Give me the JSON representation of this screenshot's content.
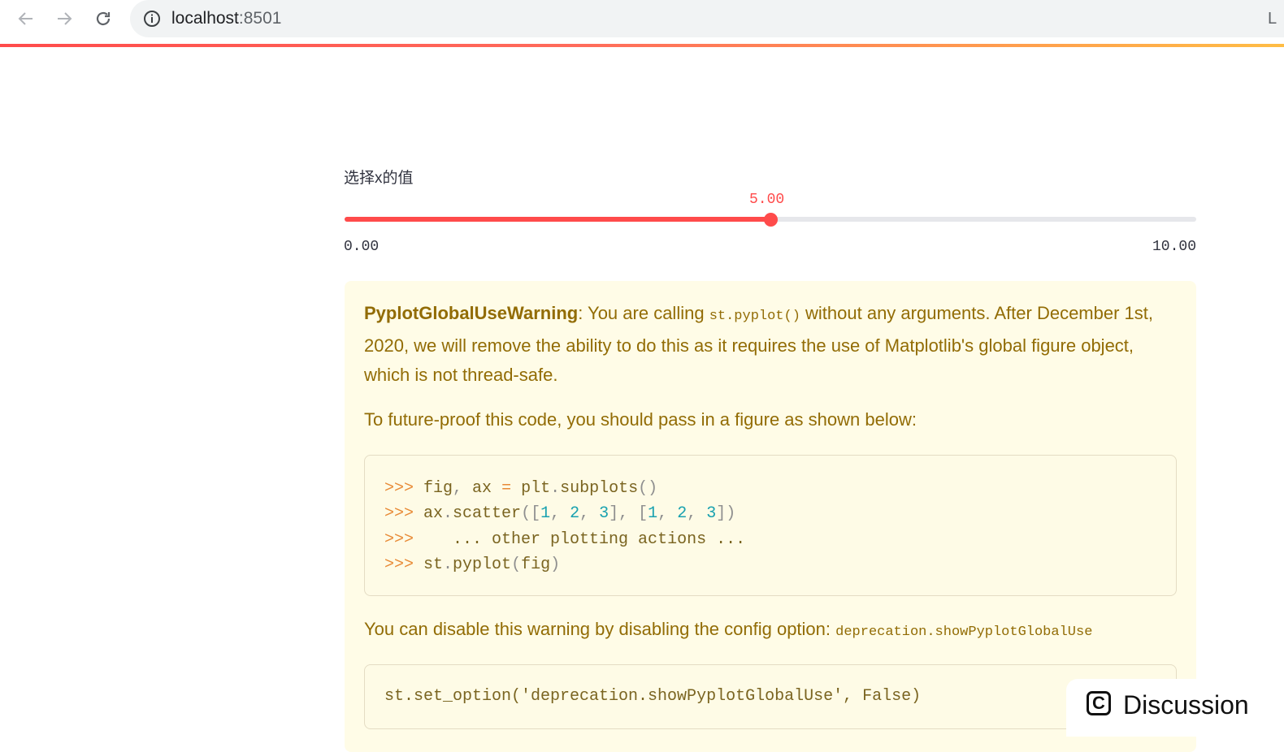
{
  "browser": {
    "url_host": "localhost",
    "url_port": ":8501",
    "edge_glyph": "L"
  },
  "slider": {
    "label": "选择x的值",
    "value_text": "5.00",
    "min_text": "0.00",
    "max_text": "10.00",
    "fraction": 0.5,
    "accent_color": "#ff4b4b"
  },
  "warning": {
    "title": "PyplotGlobalUseWarning",
    "p1_part1": ": You are calling ",
    "p1_code": "st.pyplot()",
    "p1_part2": " without any arguments. After December 1st,",
    "p1_line2": "2020, we will remove the ability to do this as it requires the use of Matplotlib's global figure object,",
    "p1_line3": "which is not thread-safe.",
    "p2": "To future-proof this code, you should pass in a figure as shown below:",
    "code_lines": [
      [
        {
          "t": ">>> ",
          "c": "tok-prompt"
        },
        {
          "t": "fig",
          "c": "tok-text"
        },
        {
          "t": ", ",
          "c": "tok-punc"
        },
        {
          "t": "ax ",
          "c": "tok-text"
        },
        {
          "t": "= ",
          "c": "tok-prompt"
        },
        {
          "t": "plt",
          "c": "tok-text"
        },
        {
          "t": ".",
          "c": "tok-punc"
        },
        {
          "t": "subplots",
          "c": "tok-text"
        },
        {
          "t": "()",
          "c": "tok-punc"
        }
      ],
      [
        {
          "t": ">>> ",
          "c": "tok-prompt"
        },
        {
          "t": "ax",
          "c": "tok-text"
        },
        {
          "t": ".",
          "c": "tok-punc"
        },
        {
          "t": "scatter",
          "c": "tok-text"
        },
        {
          "t": "([",
          "c": "tok-punc"
        },
        {
          "t": "1",
          "c": "tok-num"
        },
        {
          "t": ", ",
          "c": "tok-punc"
        },
        {
          "t": "2",
          "c": "tok-num"
        },
        {
          "t": ", ",
          "c": "tok-punc"
        },
        {
          "t": "3",
          "c": "tok-num"
        },
        {
          "t": "], [",
          "c": "tok-punc"
        },
        {
          "t": "1",
          "c": "tok-num"
        },
        {
          "t": ", ",
          "c": "tok-punc"
        },
        {
          "t": "2",
          "c": "tok-num"
        },
        {
          "t": ", ",
          "c": "tok-punc"
        },
        {
          "t": "3",
          "c": "tok-num"
        },
        {
          "t": "])",
          "c": "tok-punc"
        }
      ],
      [
        {
          "t": ">>> ",
          "c": "tok-prompt"
        },
        {
          "t": "   ... other plotting actions ...",
          "c": "tok-text"
        }
      ],
      [
        {
          "t": ">>> ",
          "c": "tok-prompt"
        },
        {
          "t": "st",
          "c": "tok-text"
        },
        {
          "t": ".",
          "c": "tok-punc"
        },
        {
          "t": "pyplot",
          "c": "tok-text"
        },
        {
          "t": "(",
          "c": "tok-punc"
        },
        {
          "t": "fig",
          "c": "tok-text"
        },
        {
          "t": ")",
          "c": "tok-punc"
        }
      ]
    ],
    "p3_text": "You can disable this warning by disabling the config option: ",
    "p3_code": "deprecation.showPyplotGlobalUse",
    "code2": "st.set_option('deprecation.showPyplotGlobalUse', False)"
  },
  "discussion": {
    "icon_letter": "C",
    "label": "Discussion"
  }
}
